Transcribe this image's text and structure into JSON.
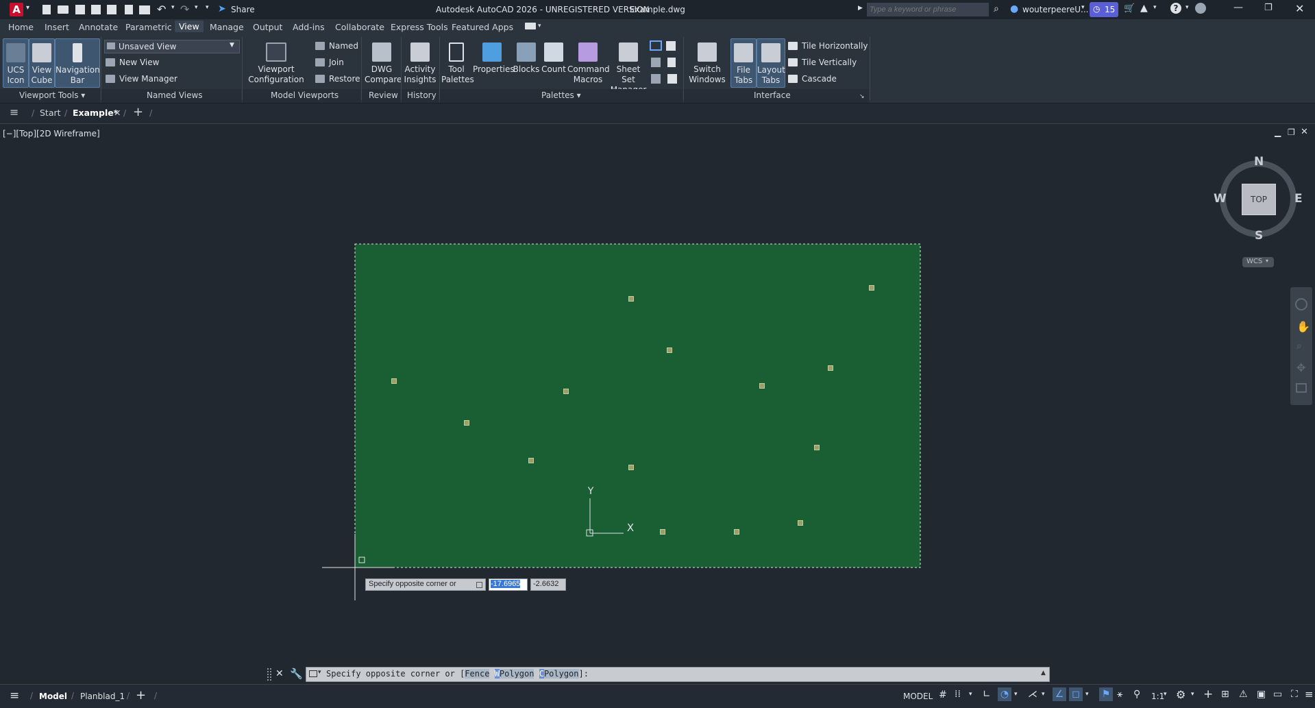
{
  "title": {
    "app": "Autodesk AutoCAD 2026 - UNREGISTERED VERSION",
    "file": "Example.dwg",
    "share": "Share",
    "search_placeholder": "Type a keyword or phrase",
    "user": "wouterpeereU...",
    "notif_count": "15"
  },
  "menu_tabs": [
    "Home",
    "Insert",
    "Annotate",
    "Parametric",
    "View",
    "Manage",
    "Output",
    "Add-ins",
    "Collaborate",
    "Express Tools",
    "Featured Apps"
  ],
  "ribbon": {
    "ucs_icon": "UCS\nIcon",
    "view_cube": "View\nCube",
    "nav_bar": "Navigation\nBar",
    "viewport_tools": "Viewport Tools",
    "unsaved_view": "Unsaved View",
    "new_view": "New View",
    "view_manager": "View Manager",
    "named_views": "Named Views",
    "viewport_config": "Viewport\nConfiguration",
    "named": "Named",
    "join": "Join",
    "restore": "Restore",
    "model_viewports": "Model Viewports",
    "dwg_compare": "DWG\nCompare",
    "review": "Review",
    "activity_insights": "Activity\nInsights",
    "history": "History",
    "tool_palettes": "Tool\nPalettes",
    "properties": "Properties",
    "blocks": "Blocks",
    "count": "Count",
    "command_macros": "Command\nMacros",
    "sheet_set_manager": "Sheet Set\nManager",
    "palettes": "Palettes",
    "switch_windows": "Switch\nWindows",
    "file_tabs": "File\nTabs",
    "layout_tabs": "Layout\nTabs",
    "tile_horizontally": "Tile Horizontally",
    "tile_vertically": "Tile Vertically",
    "cascade": "Cascade",
    "interface": "Interface"
  },
  "file_tabs": {
    "start": "Start",
    "example": "Example*"
  },
  "viewport": {
    "label": "[−][Top][2D Wireframe]",
    "compass": {
      "n": "N",
      "s": "S",
      "e": "E",
      "w": "W",
      "top": "TOP"
    },
    "wcs": "WCS",
    "ucs_y": "Y",
    "ucs_x": "X",
    "tooltip": "Specify opposite corner or",
    "coord_x": "-17.6965",
    "coord_y": "-2.6632",
    "selection_color": "#1a5e33"
  },
  "command_line": {
    "prefix": "Specify opposite corner or [",
    "fence": "Fence",
    "wpolygon_w": "W",
    "wpolygon_rest": "Polygon",
    "cpolygon_c": "C",
    "cpolygon_rest": "Polygon",
    "suffix": "]:"
  },
  "status": {
    "model_tab": "Model",
    "layout_tab": "Planblad_1",
    "model_btn": "MODEL",
    "scale": "1:1"
  }
}
